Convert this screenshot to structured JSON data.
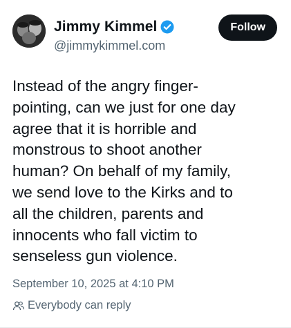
{
  "post": {
    "author": {
      "display_name": "Jimmy Kimmel",
      "handle": "@jimmykimmel.com",
      "verified": true,
      "verified_icon": "verified-badge-icon",
      "verified_color": "#1d9bf0"
    },
    "follow_button": {
      "label": "Follow",
      "background": "#0f1419",
      "text_color": "#ffffff"
    },
    "text": "Instead of the angry finger-\npointing, can we just for one day\nagree that it is horrible and\nmonstrous to shoot another\nhuman? On behalf of my family,\nwe send love to the Kirks and to\nall the children, parents and\ninnocents who fall victim to\nsenseless gun violence.",
    "timestamp": "September 10, 2025 at 4:10 PM",
    "reply_setting": {
      "icon": "people-icon",
      "label": "Everybody can reply"
    }
  }
}
